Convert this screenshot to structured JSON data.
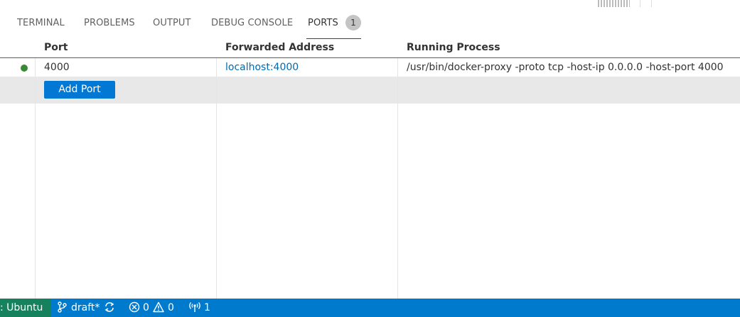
{
  "tabs": [
    {
      "label": "TERMINAL"
    },
    {
      "label": "PROBLEMS"
    },
    {
      "label": "OUTPUT"
    },
    {
      "label": "DEBUG CONSOLE"
    },
    {
      "label": "PORTS",
      "badge": "1",
      "active": true
    }
  ],
  "table": {
    "headers": [
      "Port",
      "Forwarded Address",
      "Running Process"
    ],
    "rows": [
      {
        "status": "running",
        "port": "4000",
        "address": "localhost:4000",
        "process": "/usr/bin/docker-proxy -proto tcp -host-ip 0.0.0.0 -host-port 4000"
      }
    ],
    "add_button": "Add Port"
  },
  "statusbar": {
    "remote": ": Ubuntu",
    "branch": "draft*",
    "errors": "0",
    "warnings": "0",
    "ports": "1"
  },
  "colors": {
    "accent": "#007acc",
    "remote_bg": "#16825d",
    "running_dot": "#388a34",
    "link": "#006ab1"
  }
}
